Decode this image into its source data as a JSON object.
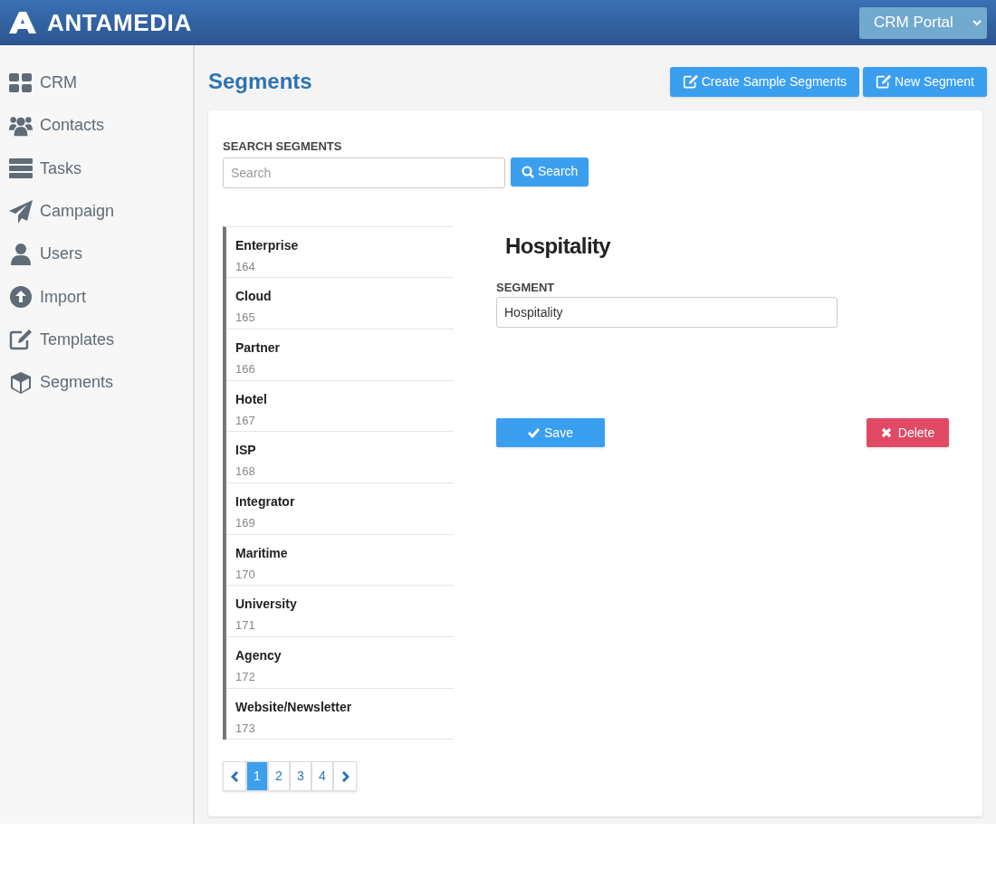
{
  "header": {
    "logo": "ANTAMEDIA",
    "portal": "CRM Portal"
  },
  "sidebar": {
    "items": [
      {
        "label": "CRM"
      },
      {
        "label": "Contacts"
      },
      {
        "label": "Tasks"
      },
      {
        "label": "Campaign"
      },
      {
        "label": "Users"
      },
      {
        "label": "Import"
      },
      {
        "label": "Templates"
      },
      {
        "label": "Segments"
      }
    ]
  },
  "page": {
    "title": "Segments",
    "buttons": [
      "Create Sample Segments",
      "New Segment"
    ]
  },
  "search": {
    "label": "SEARCH SEGMENTS",
    "placeholder": "Search",
    "button": "Search"
  },
  "segments": [
    {
      "name": "Enterprise",
      "id": "164"
    },
    {
      "name": "Cloud",
      "id": "165"
    },
    {
      "name": "Partner",
      "id": "166"
    },
    {
      "name": "Hotel",
      "id": "167"
    },
    {
      "name": "ISP",
      "id": "168"
    },
    {
      "name": "Integrator",
      "id": "169"
    },
    {
      "name": "Maritime",
      "id": "170"
    },
    {
      "name": "University",
      "id": "171"
    },
    {
      "name": "Agency",
      "id": "172"
    },
    {
      "name": "Website/Newsletter",
      "id": "173"
    }
  ],
  "pagination": [
    {
      "label": "1",
      "selected": true
    },
    {
      "label": "2",
      "selected": false
    },
    {
      "label": "3",
      "selected": false
    },
    {
      "label": "4",
      "selected": false
    }
  ],
  "detail": {
    "heading": "Hospitality",
    "field_label": "SEGMENT",
    "value": "Hospitality",
    "save": "Save",
    "delete": "Delete"
  }
}
